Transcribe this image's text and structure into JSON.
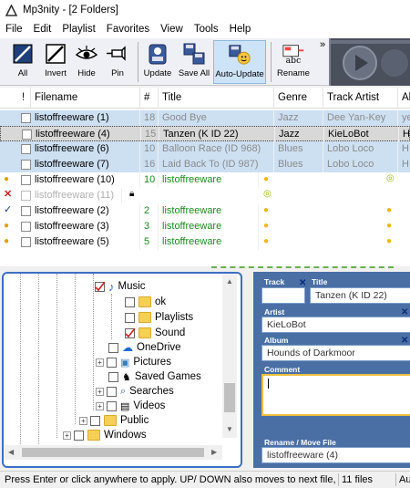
{
  "window": {
    "title": "Mp3nity - [2 Folders]"
  },
  "menu": [
    "File",
    "Edit",
    "Playlist",
    "Favorites",
    "View",
    "Tools",
    "Help"
  ],
  "toolbar": {
    "all": "All",
    "invert": "Invert",
    "hide": "Hide",
    "pin": "Pin",
    "update": "Update",
    "save_all": "Save All",
    "auto_update": "Auto-Update",
    "rename": "Rename",
    "more": "»"
  },
  "grid": {
    "headers": [
      "!",
      "Filename",
      "#",
      "Title",
      "Genre",
      "Track Artist",
      "Al"
    ],
    "rows": [
      {
        "name": "listoffreeware (1)",
        "num": "18",
        "title": "Good Bye",
        "genre": "Jazz",
        "artist": "Dee Yan-Key",
        "album": "ye"
      },
      {
        "name": "listoffreeware (4)",
        "num": "15",
        "title": "Tanzen (K ID 22)",
        "genre": "Jazz",
        "artist": "KieLoBot",
        "album": "H"
      },
      {
        "name": "listoffreeware (6)",
        "num": "10",
        "title": "Balloon Race (ID 968)",
        "genre": "Blues",
        "artist": "Lobo Loco",
        "album": "H"
      },
      {
        "name": "listoffreeware (7)",
        "num": "16",
        "title": "Laid Back To (ID 987)",
        "genre": "Blues",
        "artist": "Lobo Loco",
        "album": "H"
      },
      {
        "name": "listoffreeware (10)",
        "num": "10",
        "title": "listoffreeware",
        "genre": "",
        "artist": "",
        "album": ""
      },
      {
        "name": "listoffreeware (11)",
        "num": "",
        "title": "",
        "genre": "",
        "artist": "",
        "album": ""
      },
      {
        "name": "listoffreeware (2)",
        "num": "2",
        "title": "listoffreeware",
        "genre": "",
        "artist": "",
        "album": ""
      },
      {
        "name": "listoffreeware (3)",
        "num": "3",
        "title": "listoffreeware",
        "genre": "",
        "artist": "",
        "album": ""
      },
      {
        "name": "listoffreeware (5)",
        "num": "5",
        "title": "listoffreeware",
        "genre": "",
        "artist": "",
        "album": ""
      }
    ]
  },
  "tree": {
    "music": "Music",
    "ok": "ok",
    "playlists": "Playlists",
    "sound": "Sound",
    "onedrive": "OneDrive",
    "pictures": "Pictures",
    "saved_games": "Saved Games",
    "searches": "Searches",
    "videos": "Videos",
    "public": "Public",
    "windows": "Windows"
  },
  "editor": {
    "track_label": "Track",
    "track_value": "",
    "title_label": "Title",
    "title_value": "Tanzen (K ID 22)",
    "artist_label": "Artist",
    "artist_value": "KieLoBot",
    "album_label": "Album",
    "album_value": "Hounds of Darkmoor",
    "comment_label": "Comment",
    "comment_value": "",
    "rename_label": "Rename / Move File",
    "rename_value": "listoffreeware (4)"
  },
  "status": {
    "hint": "Press Enter or click anywhere to apply. UP/ DOWN also moves to next file, or",
    "count": "11 files",
    "right": "Au"
  }
}
